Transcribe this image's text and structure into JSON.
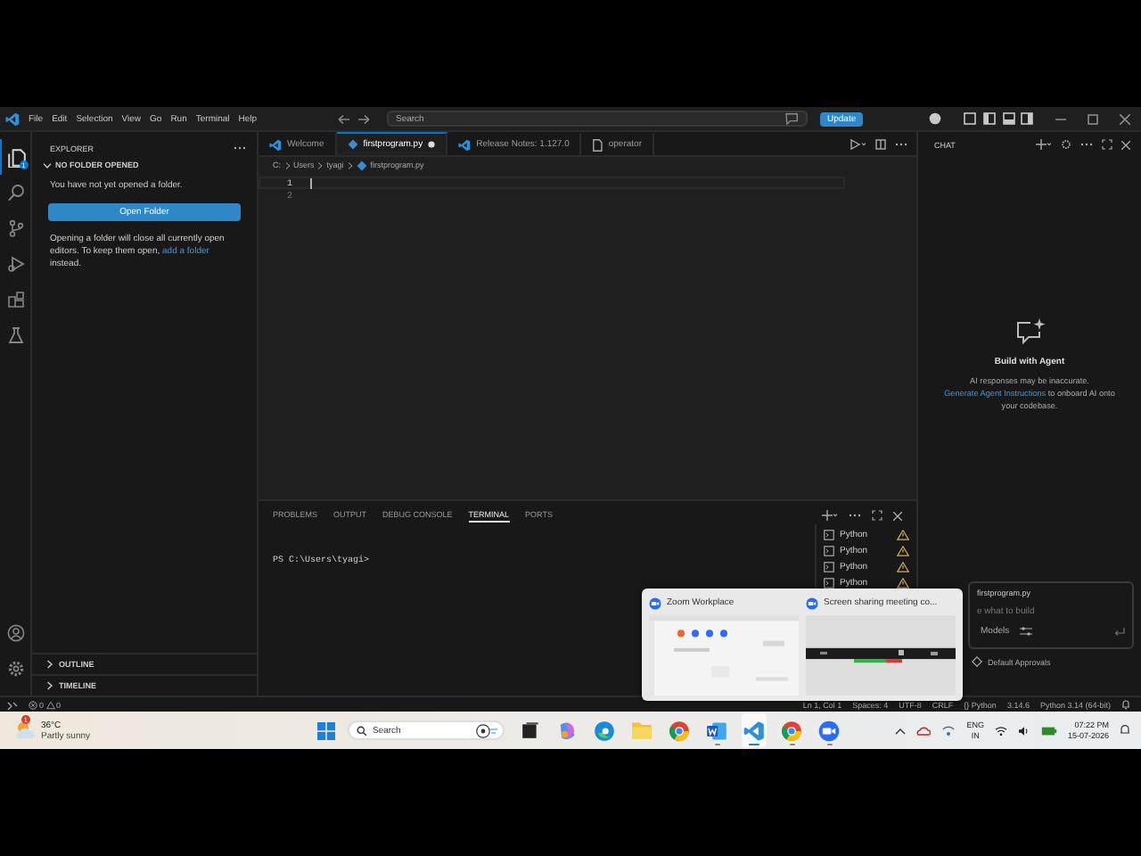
{
  "title_bar": {
    "menus": [
      "File",
      "Edit",
      "Selection",
      "View",
      "Go",
      "Run",
      "Terminal",
      "Help"
    ],
    "search": {
      "placeholder": "Search"
    },
    "update_button": "Update"
  },
  "activity_bar": [
    {
      "kind": "explorer",
      "selected": true,
      "badge": "1"
    },
    {
      "kind": "search",
      "selected": false
    },
    {
      "kind": "source-control",
      "selected": false
    },
    {
      "kind": "run",
      "selected": false
    },
    {
      "kind": "extensions",
      "selected": false
    },
    {
      "kind": "testing",
      "selected": false
    }
  ],
  "sidebar": {
    "title": "EXPLORER",
    "section": "NO FOLDER OPENED",
    "message": "You have not yet opened a folder.",
    "button": "Open Folder",
    "note_before": "Opening a folder will close all currently open editors. To keep them open, ",
    "note_link": "add a folder",
    "note_after": " instead.",
    "footer_sections": [
      "OUTLINE",
      "TIMELINE"
    ]
  },
  "tabs": [
    {
      "label": "Welcome",
      "kind": "vscode",
      "selected": false,
      "modified": false
    },
    {
      "label": "firstprogram.py",
      "kind": "python",
      "selected": true,
      "modified": true
    },
    {
      "label": "Release Notes: 1.127.0",
      "kind": "vscode",
      "selected": false,
      "modified": false
    },
    {
      "label": "operator",
      "kind": "file",
      "selected": false,
      "modified": false
    }
  ],
  "breadcrumbs": [
    "C:",
    "Users",
    "tyagi",
    "firstprogram.py"
  ],
  "editor": {
    "lines": [
      {
        "number": "1",
        "selected": true
      },
      {
        "number": "2",
        "selected": false
      }
    ]
  },
  "panel": {
    "tabs": [
      {
        "label": "PROBLEMS",
        "selected": false
      },
      {
        "label": "OUTPUT",
        "selected": false
      },
      {
        "label": "DEBUG CONSOLE",
        "selected": false
      },
      {
        "label": "TERMINAL",
        "selected": true
      },
      {
        "label": "PORTS",
        "selected": false
      }
    ],
    "terminal_text": "PS C:\\Users\\tyagi>",
    "terminals": [
      {
        "label": "Python",
        "warning": true
      },
      {
        "label": "Python",
        "warning": true
      },
      {
        "label": "Python",
        "warning": true
      },
      {
        "label": "Python",
        "warning": true
      }
    ]
  },
  "chat": {
    "title": "CHAT",
    "heading": "Build with Agent",
    "note_before": "AI responses may be inaccurate. ",
    "note_link": "Generate Agent Instructions",
    "note_after": " to onboard AI onto your codebase.",
    "context_file": "firstprogram.py",
    "placeholder": "e what to build",
    "model_button": "Models",
    "approvals": "Default Approvals"
  },
  "status_bar": {
    "errors": "0",
    "warnings": "0",
    "items": [
      "Ln 1, Col 1",
      "Spaces: 4",
      "UTF-8",
      "CRLF",
      "{} Python",
      "3.14.6",
      "Python 3.14 (64-bit)"
    ]
  },
  "taskbar_preview": [
    {
      "title": "Zoom Workplace"
    },
    {
      "title": "Screen sharing meeting co..."
    }
  ],
  "taskbar": {
    "weather": {
      "temperature": "36°C",
      "condition": "Partly sunny",
      "badge": "1"
    },
    "search": {
      "placeholder": "Search"
    },
    "apps": [
      {
        "kind": "taskview",
        "running": false,
        "selected": false
      },
      {
        "kind": "copilot",
        "running": false,
        "selected": false
      },
      {
        "kind": "edge",
        "running": false,
        "selected": false
      },
      {
        "kind": "folder",
        "running": false,
        "selected": false
      },
      {
        "kind": "chrome",
        "running": false,
        "selected": false
      },
      {
        "kind": "word",
        "running": true,
        "selected": false
      },
      {
        "kind": "vscode",
        "running": true,
        "selected": true
      },
      {
        "kind": "chrome",
        "running": true,
        "selected": false
      },
      {
        "kind": "zoom",
        "running": true,
        "selected": false
      }
    ],
    "language": [
      "ENG",
      "IN"
    ],
    "time": "07:22 PM",
    "date": "15-07-2026"
  }
}
